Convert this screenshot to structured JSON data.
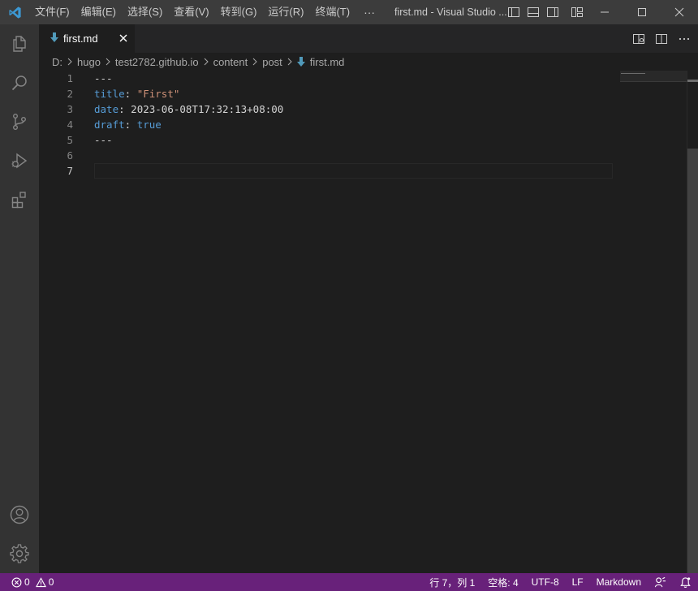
{
  "titlebar": {
    "menu": [
      "文件(F)",
      "编辑(E)",
      "选择(S)",
      "查看(V)",
      "转到(G)",
      "运行(R)",
      "终端(T)"
    ],
    "more": "···",
    "window_title": "first.md - Visual Studio ..."
  },
  "tab": {
    "label": "first.md",
    "icon": "markdown-down-arrow-icon"
  },
  "breadcrumb": {
    "items": [
      "D:",
      "hugo",
      "test2782.github.io",
      "content",
      "post"
    ],
    "file": "first.md"
  },
  "editor": {
    "line_numbers": [
      "1",
      "2",
      "3",
      "4",
      "5",
      "6",
      "7"
    ],
    "lines": {
      "l1": "---",
      "l2_key": "title",
      "l2_sep": ": ",
      "l2_val": "\"First\"",
      "l3_key": "date",
      "l3_sep": ": ",
      "l3_val": "2023-06-08T17:32:13+08:00",
      "l4_key": "draft",
      "l4_sep": ": ",
      "l4_val": "true",
      "l5": "---",
      "l6": "",
      "l7": ""
    },
    "active_line": 7
  },
  "statusbar": {
    "errors": "0",
    "warnings": "0",
    "position": "行 7，列 1",
    "spaces": "空格: 4",
    "encoding": "UTF-8",
    "eol": "LF",
    "language": "Markdown",
    "color": "#68217a"
  },
  "colors": {
    "accent_file_icon": "#519aba",
    "vscode_logo": "#3c99d4"
  }
}
